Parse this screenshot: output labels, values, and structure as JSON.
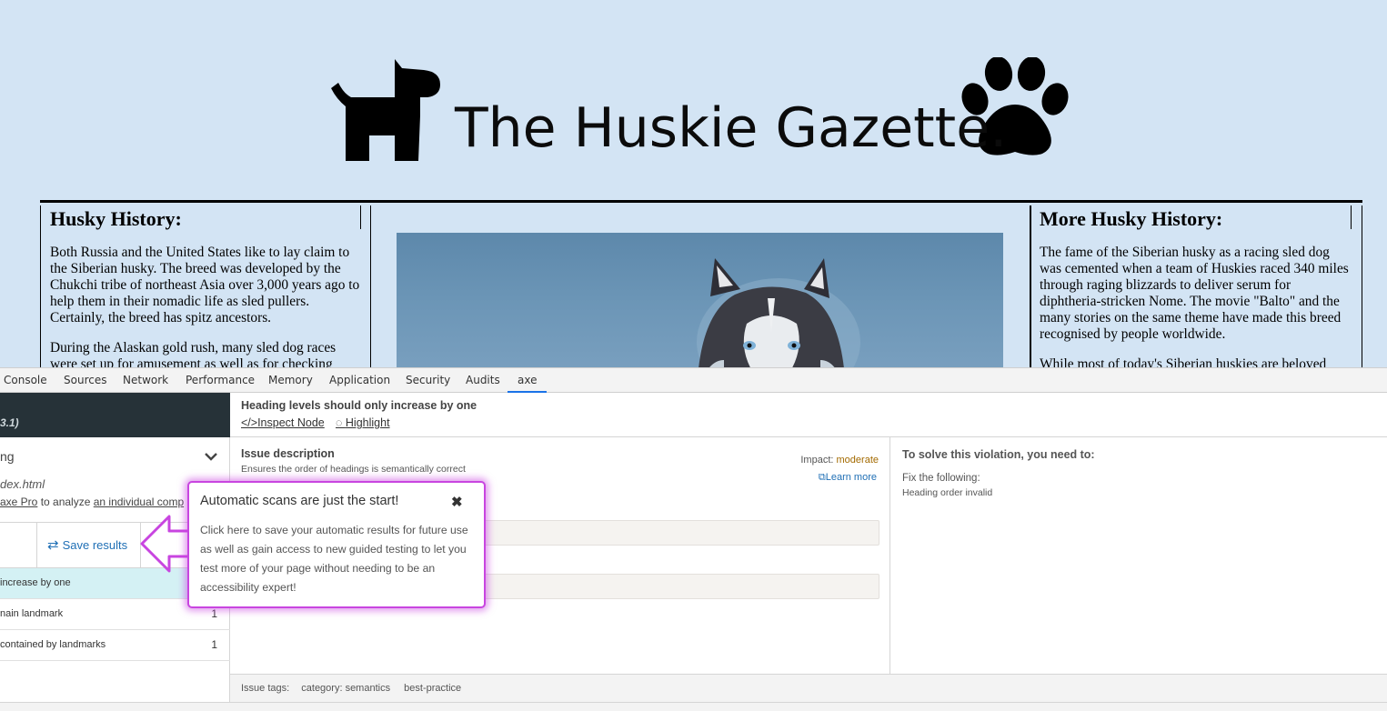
{
  "page": {
    "title": "The Huskie Gazette.",
    "left_column": {
      "heading": "Husky History:",
      "paragraphs": [
        "Both Russia and the United States like to lay claim to the Siberian husky. The breed was developed by the Chukchi tribe of northeast Asia over 3,000 years ago to help them in their nomadic life as sled pullers. Certainly, the breed has spitz ancestors.",
        "During the Alaskan gold rush, many sled dog races were set up for amusement as well as for checking"
      ]
    },
    "right_column": {
      "heading": "More Husky History:",
      "paragraphs": [
        "The fame of the Siberian husky as a racing sled dog was cemented when a team of Huskies raced 340 miles through raging blizzards to deliver serum for diphtheria-stricken Nome. The movie \"Balto\" and the many stories on the same theme have made this breed recognised by people worldwide.",
        "While most of today's Siberian huskies are beloved"
      ]
    }
  },
  "devtools": {
    "tabs": [
      "Console",
      "Sources",
      "Network",
      "Performance",
      "Memory",
      "Application",
      "Security",
      "Audits",
      "axe"
    ],
    "active_tab": "axe",
    "sidebar": {
      "version_fragment": "3.1)",
      "scan_label_fragment": "ng",
      "file_fragment": "dex.html",
      "pro_line_link": "axe Pro",
      "pro_line_text": " to analyze ",
      "pro_line_link2": "an individual comp",
      "save_results_label": "Save results",
      "issues": [
        {
          "label": "increase by one",
          "count": ""
        },
        {
          "label": "nain landmark",
          "count": "1"
        },
        {
          "label": "contained by landmarks",
          "count": "1"
        }
      ]
    },
    "detail": {
      "rule_title": "Heading levels should only increase by one",
      "inspect_node": "Inspect Node",
      "highlight": "Highlight",
      "issue_description_title": "Issue description",
      "issue_description": "Ensures the order of headings is semantically correct",
      "impact_label": "Impact:",
      "impact_value": "moderate",
      "learn_more": "Learn more",
      "solve_title": "To solve this violation, you need to:",
      "fix_the_following": "Fix the following:",
      "fix_item": "Heading order invalid",
      "tags_label": "Issue tags:",
      "tags": [
        "category: semantics",
        "best-practice"
      ]
    },
    "popover": {
      "title": "Automatic scans are just the start!",
      "close_glyph": "✖",
      "body": "Click here to save your automatic results for future use as well as gain access to new guided testing to let you test more of your page without needing to be an accessibility expert!"
    },
    "colors": {
      "page_bg": "#d3e4f4",
      "axe_header": "#263238",
      "selected_issue": "#d4f1f4",
      "link_blue": "#1f6fb5",
      "impact_moderate": "#a36a00",
      "popover_border": "#c845e0"
    }
  }
}
